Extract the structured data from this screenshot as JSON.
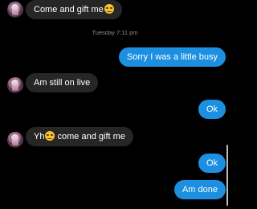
{
  "timestamp": "Tuesday 7:11 pm",
  "messages": [
    {
      "direction": "incoming",
      "text": "Come and gift me",
      "emoji": "smirk-face"
    },
    {
      "direction": "outgoing",
      "text": "Sorry I was a little busy"
    },
    {
      "direction": "incoming",
      "text": "Am still on live"
    },
    {
      "direction": "outgoing",
      "text": "Ok"
    },
    {
      "direction": "incoming",
      "text_before": "Yh",
      "emoji": "tired-face",
      "text_after": " come and gift me"
    },
    {
      "direction": "outgoing",
      "text": "Ok"
    },
    {
      "direction": "outgoing",
      "text": "Am done"
    }
  ],
  "colors": {
    "background": "#000000",
    "incoming_bubble": "#262626",
    "outgoing_bubble": "#1c8fe0",
    "timestamp_text": "#8e8e8e"
  }
}
